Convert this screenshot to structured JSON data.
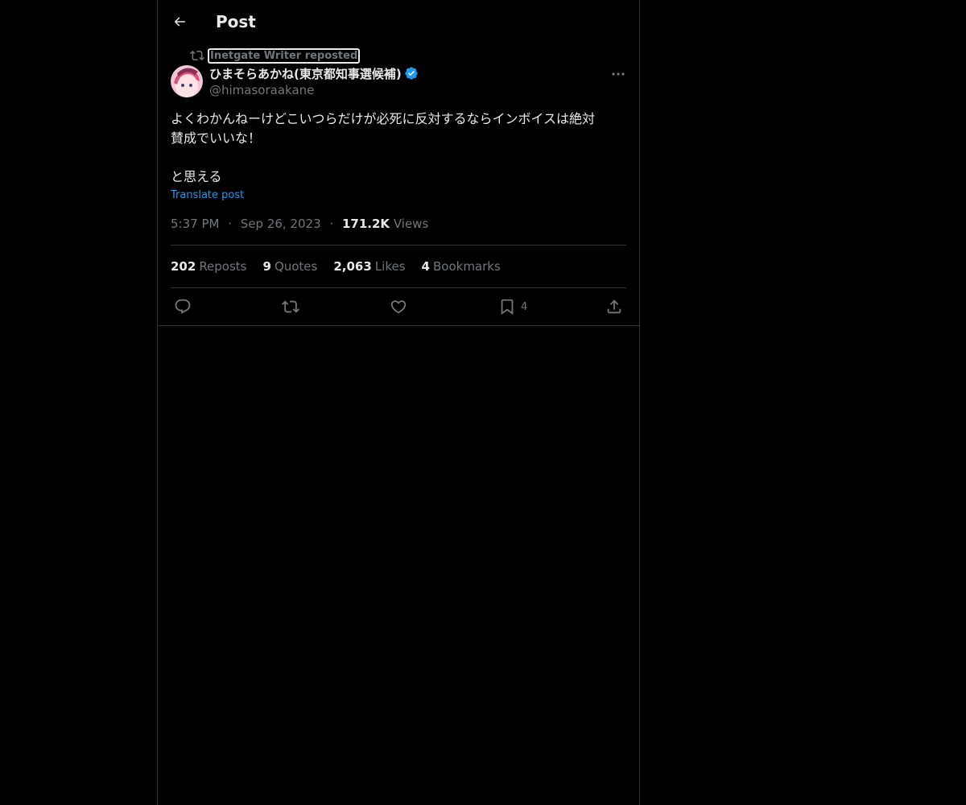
{
  "header": {
    "title": "Post"
  },
  "post": {
    "reposted_by": "Inetgate Writer reposted",
    "display_name": "ひまそらあかね(東京都知事選候補)",
    "handle": "@himasoraakane",
    "text_line1": "よくわかんねーけどこいつらだけが必死に反対するならインボイスは絶対",
    "text_line2": "賛成でいいな！",
    "text_line3": "と思える",
    "translate_label": "Translate post",
    "time": "5:37 PM",
    "date": "Sep 26, 2023",
    "views_count": "171.2K",
    "views_label": "Views",
    "separator": "·"
  },
  "stats": {
    "reposts_count": "202",
    "reposts_label": "Reposts",
    "quotes_count": "9",
    "quotes_label": "Quotes",
    "likes_count": "2,063",
    "likes_label": "Likes",
    "bookmarks_count": "4",
    "bookmarks_label": "Bookmarks"
  },
  "actions": {
    "reply_icon": "reply-icon",
    "repost_icon": "repost-icon",
    "like_icon": "heart-icon",
    "bookmark_icon": "bookmark-icon",
    "bookmark_count": "4",
    "share_icon": "share-icon"
  },
  "colors": {
    "background": "#000000",
    "text_primary": "#e7e9ea",
    "text_secondary": "#71767b",
    "accent": "#1d9bf0",
    "border": "#2f3336"
  }
}
